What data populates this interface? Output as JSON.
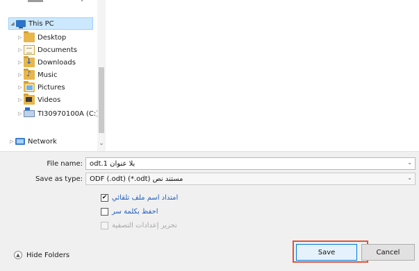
{
  "window": {
    "width": 603,
    "height": 391
  },
  "tree": {
    "items": [
      {
        "label": "This PC",
        "icon": "pc-icon",
        "expanded": true,
        "selected": true
      },
      {
        "label": "Desktop",
        "icon": "folder-icon"
      },
      {
        "label": "Documents",
        "icon": "documents-icon"
      },
      {
        "label": "Downloads",
        "icon": "downloads-icon"
      },
      {
        "label": "Music",
        "icon": "music-icon"
      },
      {
        "label": "Pictures",
        "icon": "pictures-icon"
      },
      {
        "label": "Videos",
        "icon": "videos-icon"
      },
      {
        "label": "TI30970100A (C:)",
        "icon": "drive-icon"
      },
      {
        "label": "Network",
        "icon": "network-icon"
      }
    ]
  },
  "form": {
    "file_name_label": "File name:",
    "file_name_value": "بلا عنوان 1.odt",
    "save_as_type_label": "Save as type:",
    "save_as_type_value": "مستند نص ODF (.odt) (*.odt)"
  },
  "options": {
    "auto_extension_label": "امتداد اسم ملف تلقائي",
    "auto_extension_checked": true,
    "save_password_label": "احفظ بكلمة سر",
    "save_password_checked": false,
    "edit_filter_label": "تحرير إعدادات التصفية",
    "edit_filter_checked": false
  },
  "footer": {
    "hide_folders_label": "Hide Folders",
    "save_label": "Save",
    "cancel_label": "Cancel"
  },
  "colors": {
    "highlight_border": "#e2513a",
    "selected_bg": "#cce8ff",
    "link_blue": "#1f5fbf"
  }
}
